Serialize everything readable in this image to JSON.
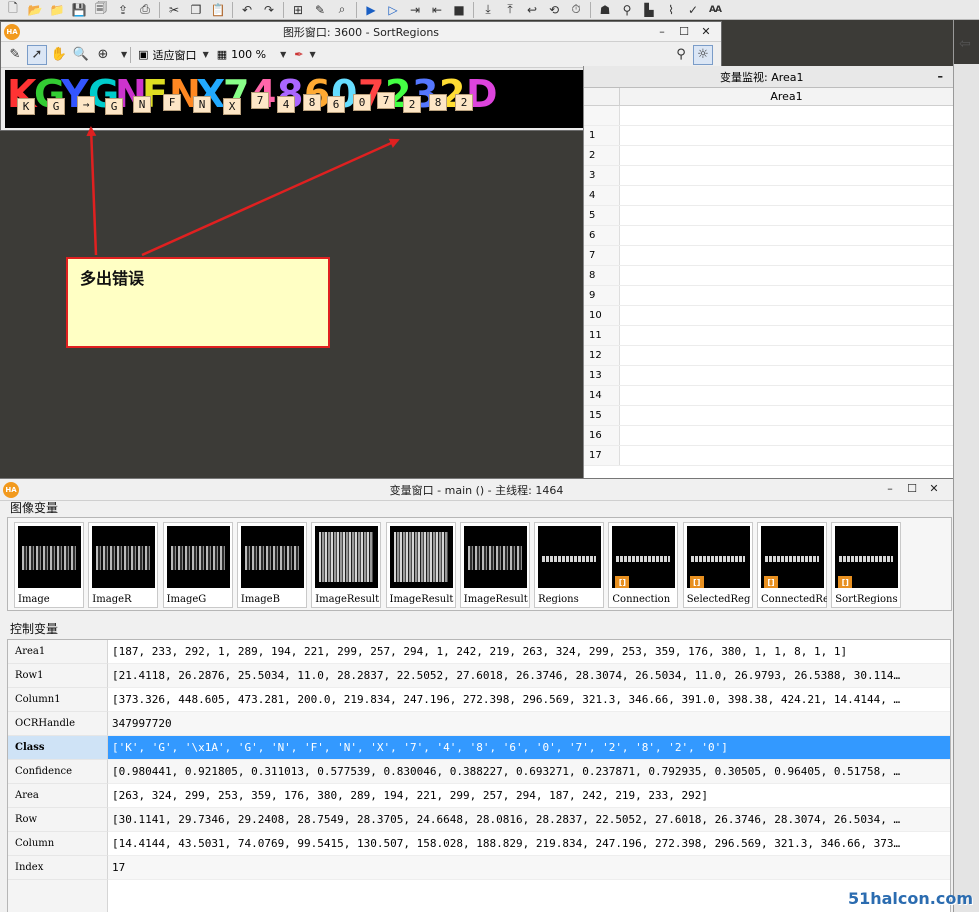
{
  "colors": {
    "accent_selected": "#3399ff",
    "callout_border": "#e02020",
    "callout_fill": "#ffffc4",
    "label_box": "#fde6c6",
    "halcon_orange": "#f29a1e"
  },
  "toolbar": {
    "icons": [
      "new-file-icon",
      "open-icon",
      "open-examples-icon",
      "save-icon",
      "save-all-icon",
      "export-icon",
      "print-icon",
      "cut-icon",
      "copy-icon",
      "paste-icon",
      "undo-icon",
      "redo-icon",
      "insert-icon",
      "edit-icon",
      "find-icon",
      "run-icon",
      "step-icon",
      "step-over-icon",
      "step-back-icon",
      "stop-icon",
      "step-into-icon",
      "step-out-icon",
      "return-icon",
      "reset-icon",
      "profiler-icon",
      "assistant-icon",
      "inspect-icon",
      "histogram-icon",
      "line-profile-icon",
      "feature-icon",
      "ocr-icon"
    ]
  },
  "graphics_window": {
    "title": "图形窗口: 3600 - SortRegions",
    "logo": "HA",
    "fit_label": "适应窗口",
    "zoom_label": "100 %",
    "big_text": [
      {
        "ch": "K",
        "color": "#ff3333"
      },
      {
        "ch": "G",
        "color": "#33cc33"
      },
      {
        "ch": "Y",
        "color": "#3355ff"
      },
      {
        "ch": "G",
        "color": "#00cccc"
      },
      {
        "ch": "N",
        "color": "#cc33cc"
      },
      {
        "ch": "F",
        "color": "#dddd22"
      },
      {
        "ch": "N",
        "color": "#ff8822"
      },
      {
        "ch": "X",
        "color": "#22aaff"
      },
      {
        "ch": "7",
        "color": "#88ff88"
      },
      {
        "ch": "4",
        "color": "#ff66aa"
      },
      {
        "ch": "8",
        "color": "#aa66ff"
      },
      {
        "ch": "6",
        "color": "#ffaa33"
      },
      {
        "ch": "0",
        "color": "#66ddff"
      },
      {
        "ch": "7",
        "color": "#ff4444"
      },
      {
        "ch": "2",
        "color": "#44ff44"
      },
      {
        "ch": "3",
        "color": "#5577ff"
      },
      {
        "ch": "2",
        "color": "#ffdd33"
      },
      {
        "ch": "D",
        "color": "#dd44dd"
      }
    ],
    "labels": [
      "K",
      "G",
      "→",
      "G",
      "N",
      "F",
      "N",
      "X",
      "7",
      "4",
      "8",
      "6",
      "0",
      "7",
      "2",
      "8",
      "2"
    ]
  },
  "annotation": {
    "text": "多出错误"
  },
  "variable_monitor": {
    "title": "变量监视: Area1",
    "column": "Area1",
    "rows": [
      "1",
      "2",
      "3",
      "4",
      "5",
      "6",
      "7",
      "8",
      "9",
      "10",
      "11",
      "12",
      "13",
      "14",
      "15",
      "16",
      "17"
    ]
  },
  "variable_window": {
    "title": "变量窗口 - main () - 主线程: 1464",
    "logo": "HA",
    "image_section": "图像变量",
    "control_section": "控制变量",
    "images": [
      {
        "name": "Image",
        "style": "stripes",
        "region": false
      },
      {
        "name": "ImageR",
        "style": "stripes",
        "region": false
      },
      {
        "name": "ImageG",
        "style": "stripes",
        "region": false
      },
      {
        "name": "ImageB",
        "style": "stripes",
        "region": false
      },
      {
        "name": "ImageResult",
        "style": "noisy",
        "region": false
      },
      {
        "name": "ImageResult",
        "style": "noisy",
        "region": false
      },
      {
        "name": "ImageResult",
        "style": "stripes",
        "region": false
      },
      {
        "name": "Regions",
        "style": "thin",
        "region": false
      },
      {
        "name": "Connection",
        "style": "thin",
        "region": true
      },
      {
        "name": "SelectedReg",
        "style": "thin",
        "region": true
      },
      {
        "name": "ConnectedRe",
        "style": "thin",
        "region": true
      },
      {
        "name": "SortRegions",
        "style": "thin",
        "region": true
      }
    ],
    "controls": [
      {
        "name": "Area1",
        "value": "[187, 233, 292, 1, 289, 194, 221, 299, 257, 294, 1, 242, 219, 263, 324, 299, 253, 359, 176, 380, 1, 1, 8, 1, 1]"
      },
      {
        "name": "Row1",
        "value": "[21.4118, 26.2876, 25.5034, 11.0, 28.2837, 22.5052, 27.6018, 26.3746, 28.3074, 26.5034, 11.0, 26.9793, 26.5388, 30.114…"
      },
      {
        "name": "Column1",
        "value": "[373.326, 448.605, 473.281, 200.0, 219.834, 247.196, 272.398, 296.569, 321.3, 346.66, 391.0, 398.38, 424.21, 14.4144, …"
      },
      {
        "name": "OCRHandle",
        "value": "347997720"
      },
      {
        "name": "Class",
        "value": "['K', 'G', '\\x1A', 'G', 'N', 'F', 'N', 'X', '7', '4', '8', '6', '0', '7', '2', '8', '2', '0']"
      },
      {
        "name": "Confidence",
        "value": "[0.980441, 0.921805, 0.311013, 0.577539, 0.830046, 0.388227, 0.693271, 0.237871, 0.792935, 0.30505, 0.96405, 0.51758, …"
      },
      {
        "name": "Area",
        "value": "[263, 324, 299, 253, 359, 176, 380, 289, 194, 221, 299, 257, 294, 187, 242, 219, 233, 292]"
      },
      {
        "name": "Row",
        "value": "[30.1141, 29.7346, 29.2408, 28.7549, 28.3705, 24.6648, 28.0816, 28.2837, 22.5052, 27.6018, 26.3746, 28.3074, 26.5034, …"
      },
      {
        "name": "Column",
        "value": "[14.4144, 43.5031, 74.0769, 99.5415, 130.507, 158.028, 188.829, 219.834, 247.196, 272.398, 296.569, 321.3, 346.66, 373…"
      },
      {
        "name": "Index",
        "value": "17"
      }
    ],
    "selected_control": "Class"
  },
  "watermark": "51halcon.com"
}
